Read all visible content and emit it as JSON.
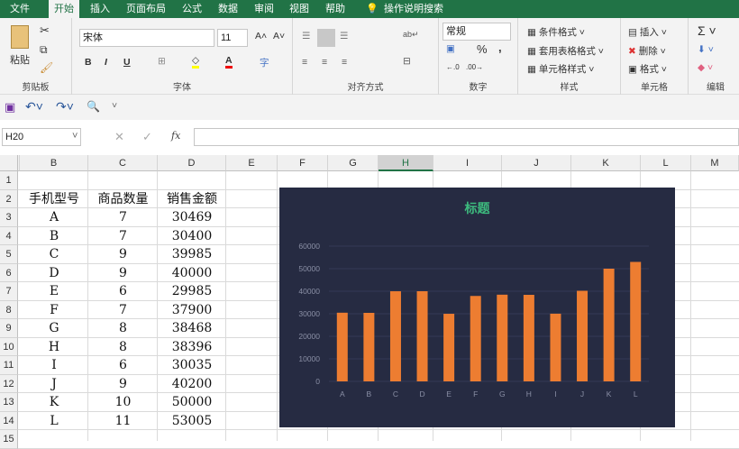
{
  "tabs": [
    "文件",
    "开始",
    "插入",
    "页面布局",
    "公式",
    "数据",
    "审阅",
    "视图",
    "帮助",
    "操作说明搜索"
  ],
  "ribbon": {
    "clipboard": {
      "paste": "粘贴",
      "label": "剪贴板"
    },
    "font": {
      "name": "宋体",
      "size": "11",
      "bold": "B",
      "italic": "I",
      "underline": "U",
      "label": "字体"
    },
    "align": {
      "label": "对齐方式"
    },
    "number": {
      "format": "常规",
      "percent": "%",
      "comma": ",",
      "label": "数字"
    },
    "styles": {
      "cond": "条件格式",
      "table": "套用表格格式",
      "cell": "单元格样式",
      "label": "样式"
    },
    "cells": {
      "insert": "插入",
      "delete": "删除",
      "format": "格式",
      "label": "单元格"
    },
    "editing": {
      "label": "编辑"
    }
  },
  "namebox": "H20",
  "fx": "fx",
  "columns": [
    "B",
    "C",
    "D",
    "E",
    "F",
    "G",
    "H",
    "I",
    "J",
    "K",
    "L",
    "M"
  ],
  "rows": [
    "1",
    "2",
    "3",
    "4",
    "5",
    "6",
    "7",
    "8",
    "9",
    "10",
    "11",
    "12",
    "13",
    "14",
    "15"
  ],
  "table": {
    "headers": [
      "手机型号",
      "商品数量",
      "销售金额"
    ],
    "rows": [
      [
        "A",
        "7",
        "30469"
      ],
      [
        "B",
        "7",
        "30400"
      ],
      [
        "C",
        "9",
        "39985"
      ],
      [
        "D",
        "9",
        "40000"
      ],
      [
        "E",
        "6",
        "29985"
      ],
      [
        "F",
        "7",
        "37900"
      ],
      [
        "G",
        "8",
        "38468"
      ],
      [
        "H",
        "8",
        "38396"
      ],
      [
        "I",
        "6",
        "30035"
      ],
      [
        "J",
        "9",
        "40200"
      ],
      [
        "K",
        "10",
        "50000"
      ],
      [
        "L",
        "11",
        "53005"
      ]
    ]
  },
  "chart_data": {
    "type": "bar",
    "title": "标题",
    "categories": [
      "A",
      "B",
      "C",
      "D",
      "E",
      "F",
      "G",
      "H",
      "I",
      "J",
      "K",
      "L"
    ],
    "values": [
      30469,
      30400,
      39985,
      40000,
      29985,
      37900,
      38468,
      38396,
      30035,
      40200,
      50000,
      53005
    ],
    "yticks": [
      "0",
      "10000",
      "20000",
      "30000",
      "40000",
      "50000",
      "60000"
    ],
    "ylim": [
      0,
      60000
    ],
    "grid": true,
    "colors": {
      "bar": "#ed7d31",
      "bg": "#262b42",
      "title": "#3dbb7e"
    }
  }
}
